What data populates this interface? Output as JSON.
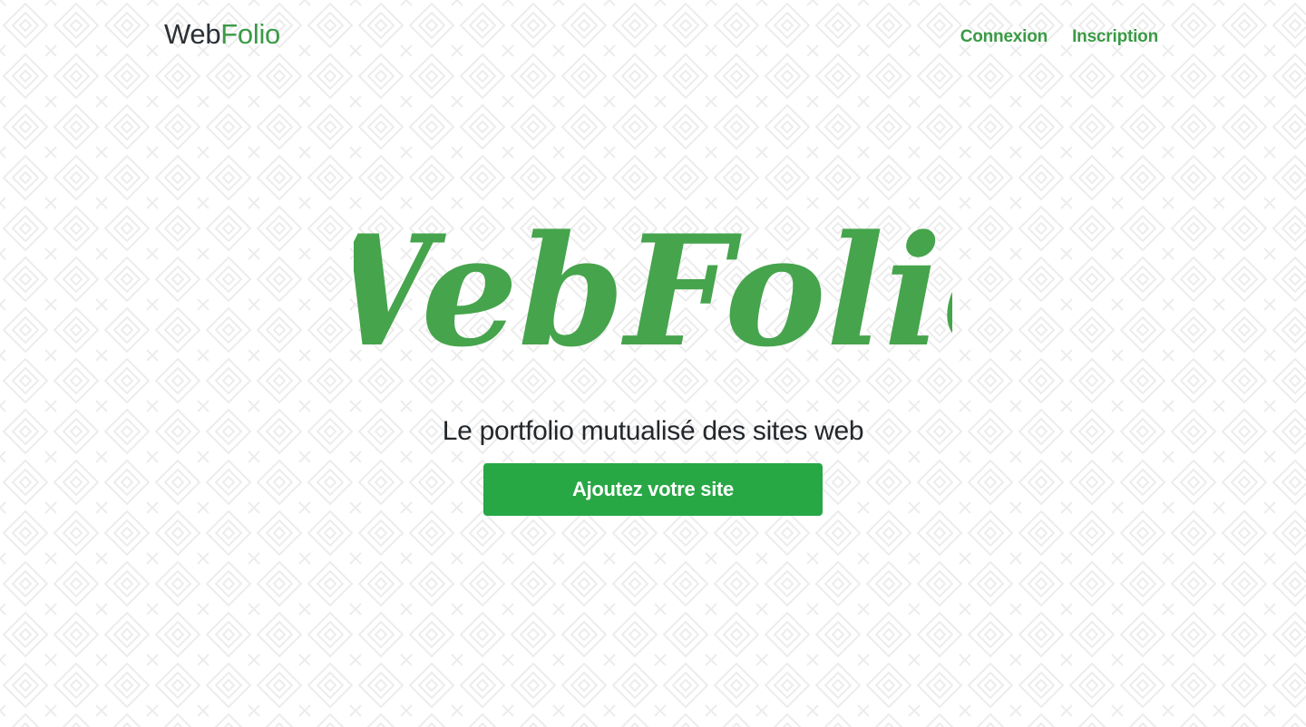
{
  "navbar": {
    "brand": {
      "part1": "Web",
      "part2": "Folio"
    },
    "links": [
      {
        "label": "Connexion"
      },
      {
        "label": "Inscription"
      }
    ]
  },
  "hero": {
    "logo_text": "WebFolio",
    "tagline": "Le portfolio mutualisé des sites web",
    "cta_label": "Ajoutez votre site"
  },
  "colors": {
    "accent": "#3a9a45",
    "button": "#28a745",
    "text_dark": "#2b3035"
  }
}
